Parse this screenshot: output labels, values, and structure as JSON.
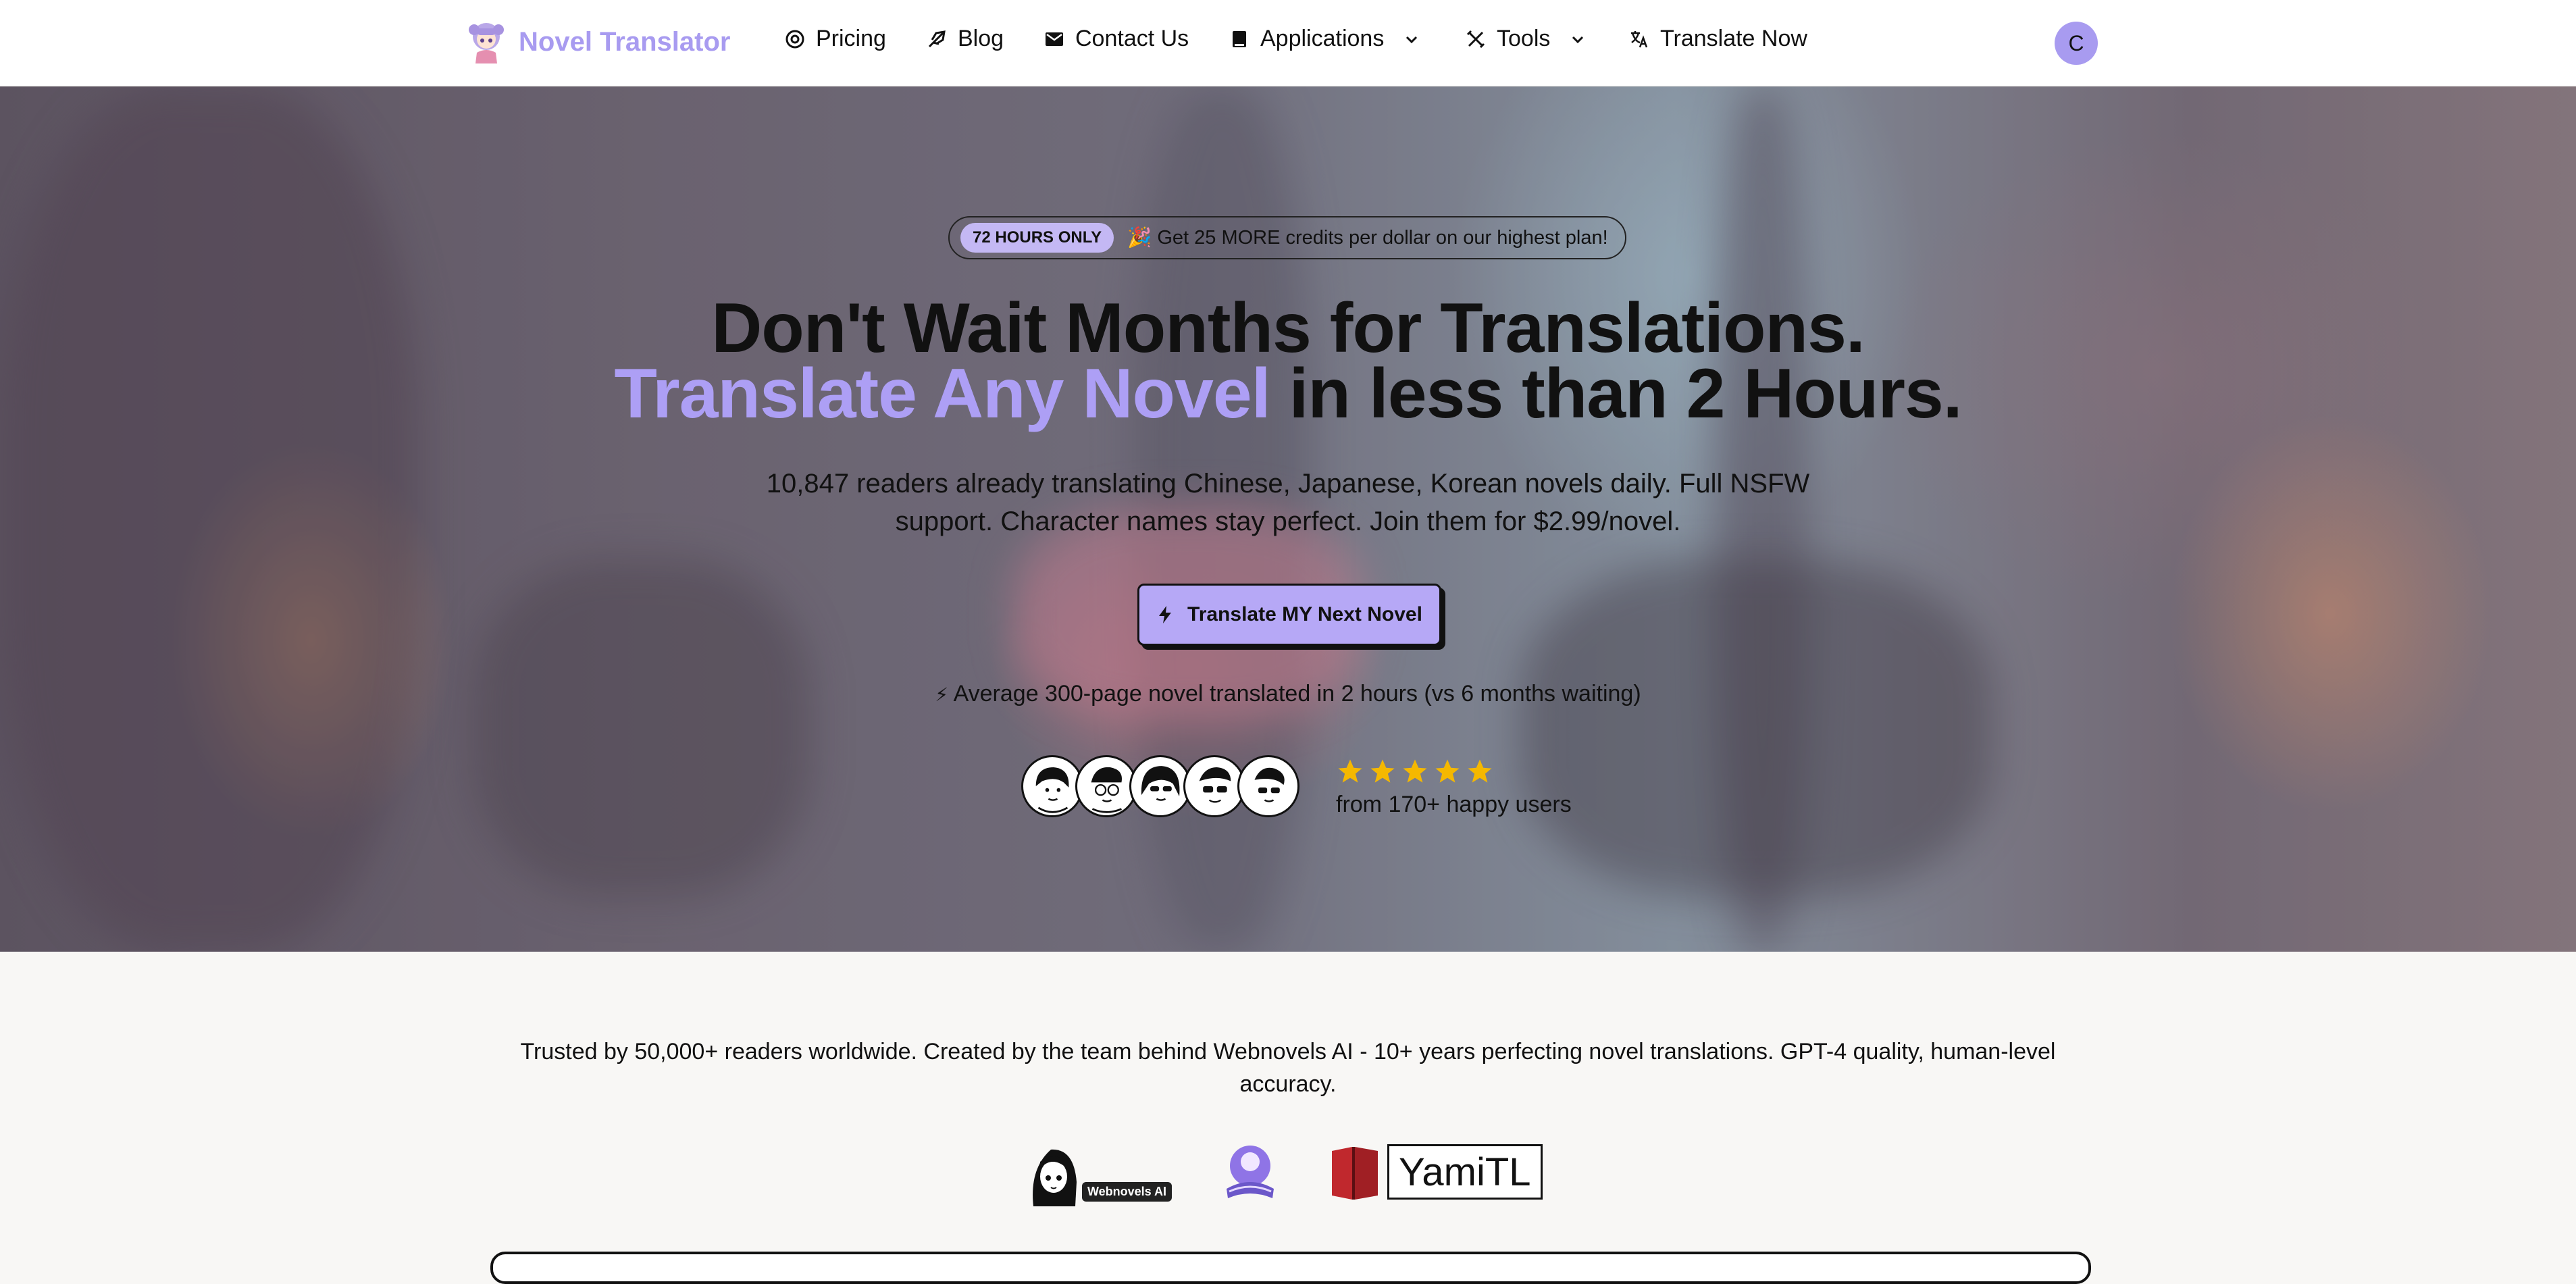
{
  "nav": {
    "brand": "Novel Translator",
    "items": [
      {
        "label": "Pricing",
        "icon": "pricing-icon"
      },
      {
        "label": "Blog",
        "icon": "quill-icon"
      },
      {
        "label": "Contact Us",
        "icon": "mail-icon"
      },
      {
        "label": "Applications",
        "icon": "book-icon",
        "dropdown": true
      },
      {
        "label": "Tools",
        "icon": "tools-icon",
        "dropdown": true
      },
      {
        "label": "Translate Now",
        "icon": "translate-icon"
      }
    ],
    "avatar_initial": "C"
  },
  "hero": {
    "promo_badge": "72 HOURS ONLY",
    "promo_text": "🎉 Get 25 MORE credits per dollar on our highest plan!",
    "headline_line1": "Don't Wait Months for Translations.",
    "headline_line2_accent": "Translate Any Novel",
    "headline_line2_rest": " in less than 2 Hours.",
    "subtext": "10,847 readers already translating Chinese, Japanese, Korean novels daily. Full NSFW support. Character names stay perfect. Join them for $2.99/novel.",
    "cta_label": "Translate MY Next Novel",
    "stat_icon": "⚡",
    "stat_text": "Average 300-page novel translated in 2 hours (vs 6 months waiting)",
    "rating_stars": 5,
    "happy_users": "from 170+ happy users"
  },
  "trust": {
    "text": "Trusted by 50,000+ readers worldwide. Created by the team behind Webnovels AI - 10+ years perfecting novel translations. GPT-4 quality, human-level accuracy.",
    "logos": [
      {
        "name": "Webnovels AI",
        "label": "Webnovels AI"
      },
      {
        "name": "orb-logo"
      },
      {
        "name": "YamiTL",
        "label": "YamiTL"
      }
    ]
  },
  "colors": {
    "accent": "#ad9ff5",
    "cta_bg": "#b6a8f6",
    "star": "#f5b800",
    "page_bg": "#f8f7f5"
  }
}
